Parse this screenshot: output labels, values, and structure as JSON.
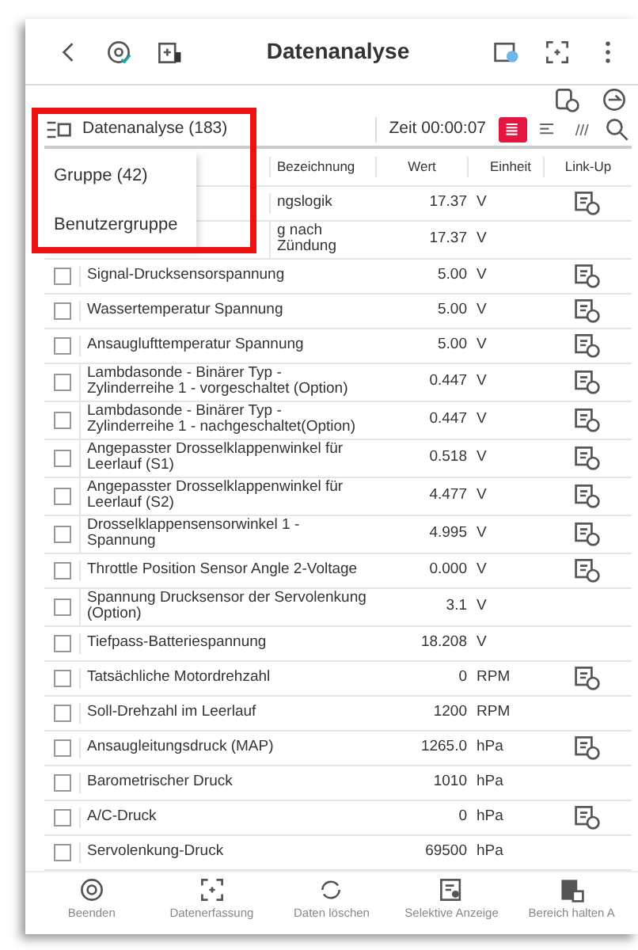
{
  "header": {
    "title": "Datenanalyse"
  },
  "toolbar": {
    "group_label": "Datenanalyse (183)",
    "time": "Zeit 00:00:07",
    "views": [
      {
        "kind": "list",
        "selected": true
      },
      {
        "kind": "align",
        "selected": false
      },
      {
        "kind": "bars",
        "selected": false
      }
    ]
  },
  "group_menu": {
    "items": [
      {
        "label": "Gruppe (42)"
      },
      {
        "label": "Benutzergruppe"
      }
    ]
  },
  "table": {
    "columns": [
      "Bezeichnung",
      "Wert",
      "Einheit",
      "Link-Up"
    ],
    "rows": [
      {
        "name": "ngslogik",
        "value": "17.37",
        "unit": "V",
        "covered": true,
        "link": true
      },
      {
        "name": "g nach Zündung",
        "value": "17.37",
        "unit": "V",
        "covered": true,
        "link": false
      },
      {
        "name": "Signal-Drucksensorspannung",
        "value": "5.00",
        "unit": "V",
        "checked": false,
        "link": true
      },
      {
        "name": "Wassertemperatur Spannung",
        "value": "5.00",
        "unit": "V",
        "checked": false,
        "link": true
      },
      {
        "name": "Ansauglufttemperatur Spannung",
        "value": "5.00",
        "unit": "V",
        "checked": false,
        "link": true
      },
      {
        "name": "Lambdasonde - Binärer Typ - Zylinderreihe 1 - vorgeschaltet (Option)",
        "value": "0.447",
        "unit": "V",
        "checked": false,
        "link": true
      },
      {
        "name": "Lambdasonde - Binärer Typ - Zylinderreihe 1 - nachgeschaltet(Option)",
        "value": "0.447",
        "unit": "V",
        "checked": false,
        "link": true
      },
      {
        "name": "Angepasster Drosselklappenwinkel für Leerlauf (S1)",
        "value": "0.518",
        "unit": "V",
        "checked": false,
        "link": true
      },
      {
        "name": "Angepasster Drosselklappenwinkel für Leerlauf (S2)",
        "value": "4.477",
        "unit": "V",
        "checked": false,
        "link": true
      },
      {
        "name": "Drosselklappensensorwinkel 1 - Spannung",
        "value": "4.995",
        "unit": "V",
        "checked": false,
        "link": true
      },
      {
        "name": "Throttle Position Sensor Angle 2-Voltage",
        "value": "0.000",
        "unit": "V",
        "checked": false,
        "link": true
      },
      {
        "name": "Spannung Drucksensor der Servolenkung (Option)",
        "value": "3.1",
        "unit": "V",
        "checked": false,
        "link": false
      },
      {
        "name": "Tiefpass-Batteriespannung",
        "value": "18.208",
        "unit": "V",
        "checked": false,
        "link": false
      },
      {
        "name": "Tatsächliche Motordrehzahl",
        "value": "0",
        "unit": "RPM",
        "checked": false,
        "link": true
      },
      {
        "name": "Soll-Drehzahl im Leerlauf",
        "value": "1200",
        "unit": "RPM",
        "checked": false,
        "link": false
      },
      {
        "name": "Ansaugleitungsdruck (MAP)",
        "value": "1265.0",
        "unit": "hPa",
        "checked": false,
        "link": true
      },
      {
        "name": "Barometrischer Druck",
        "value": "1010",
        "unit": "hPa",
        "checked": false,
        "link": false
      },
      {
        "name": "A/C-Druck",
        "value": "0",
        "unit": "hPa",
        "checked": false,
        "link": true
      },
      {
        "name": "Servolenkung-Druck",
        "value": "69500",
        "unit": "hPa",
        "checked": false,
        "link": false
      }
    ]
  },
  "bottom_bar": [
    {
      "kind": "stop",
      "label": "Beenden"
    },
    {
      "kind": "capture",
      "label": "Datenerfassung"
    },
    {
      "kind": "refresh",
      "label": "Daten löschen"
    },
    {
      "kind": "select",
      "label": "Selektive Anzeige"
    },
    {
      "kind": "hold",
      "label": "Bereich halten A"
    }
  ]
}
